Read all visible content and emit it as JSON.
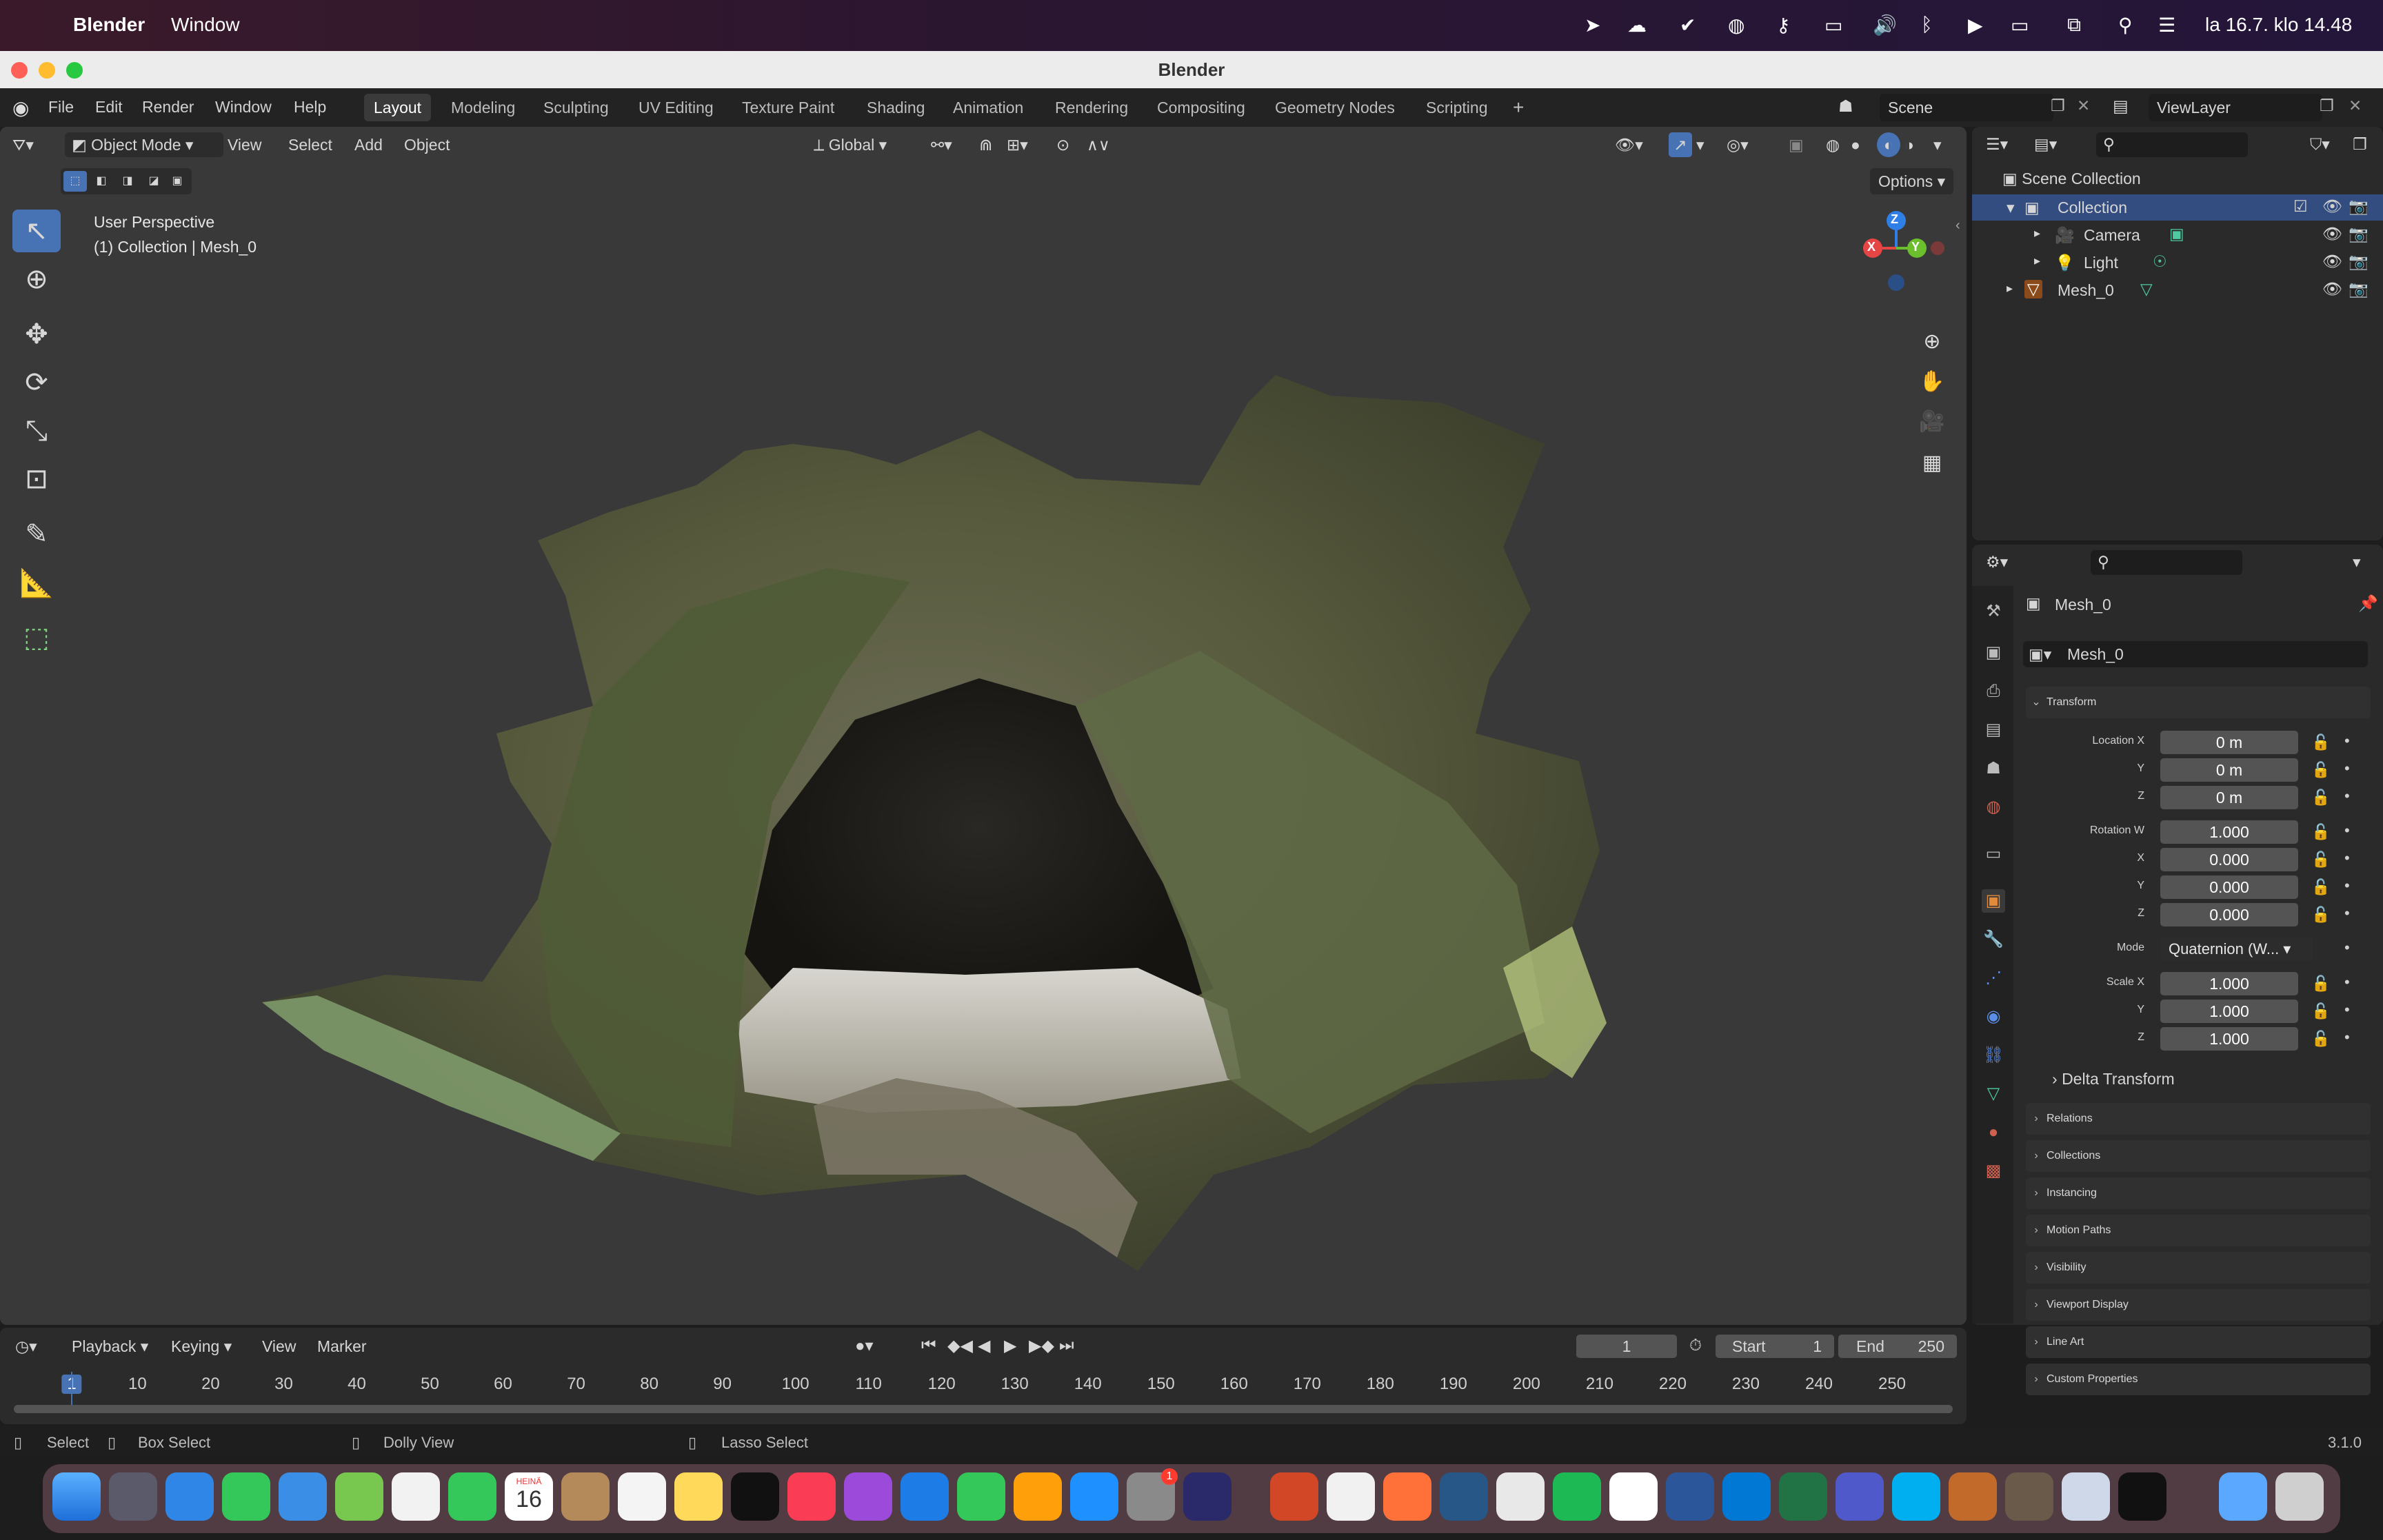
{
  "mac_menubar": {
    "app_name": "Blender",
    "menu": "Window",
    "clock": "la 16.7. klo 14.48"
  },
  "window": {
    "title": "Blender"
  },
  "topbar": {
    "menus": [
      "File",
      "Edit",
      "Render",
      "Window",
      "Help"
    ],
    "workspaces": [
      "Layout",
      "Modeling",
      "Sculpting",
      "UV Editing",
      "Texture Paint",
      "Shading",
      "Animation",
      "Rendering",
      "Compositing",
      "Geometry Nodes",
      "Scripting"
    ],
    "active_workspace": "Layout",
    "add_workspace": "+",
    "scene": "Scene",
    "view_layer": "ViewLayer"
  },
  "viewport": {
    "mode": "Object Mode",
    "menus": [
      "View",
      "Select",
      "Add",
      "Object"
    ],
    "transform_orientation": "Global",
    "options_label": "Options",
    "overlay_line1": "User Perspective",
    "overlay_line2": "(1) Collection | Mesh_0",
    "gizmo": {
      "x": "X",
      "y": "Y",
      "z": "Z"
    }
  },
  "outliner": {
    "scene_collection": "Scene Collection",
    "collection": "Collection",
    "items": [
      "Camera",
      "Light",
      "Mesh_0"
    ]
  },
  "properties": {
    "object_name": "Mesh_0",
    "data_name": "Mesh_0",
    "transform_label": "Transform",
    "location": {
      "label_x": "Location X",
      "label_y": "Y",
      "label_z": "Z",
      "x": "0 m",
      "y": "0 m",
      "z": "0 m"
    },
    "rotation": {
      "label_w": "Rotation W",
      "label_x": "X",
      "label_y": "Y",
      "label_z": "Z",
      "w": "1.000",
      "x": "0.000",
      "y": "0.000",
      "z": "0.000"
    },
    "mode_label": "Mode",
    "mode_value": "Quaternion (W...",
    "scale": {
      "label_x": "Scale X",
      "label_y": "Y",
      "label_z": "Z",
      "x": "1.000",
      "y": "1.000",
      "z": "1.000"
    },
    "delta_transform": "Delta Transform",
    "panels": [
      "Relations",
      "Collections",
      "Instancing",
      "Motion Paths",
      "Visibility",
      "Viewport Display",
      "Line Art",
      "Custom Properties"
    ]
  },
  "timeline": {
    "menus": [
      "Playback",
      "Keying",
      "View",
      "Marker"
    ],
    "current_frame": "1",
    "start_label": "Start",
    "start": "1",
    "end_label": "End",
    "end": "250",
    "ticks": [
      "1",
      "10",
      "20",
      "30",
      "40",
      "50",
      "60",
      "70",
      "80",
      "90",
      "100",
      "110",
      "120",
      "130",
      "140",
      "150",
      "160",
      "170",
      "180",
      "190",
      "200",
      "210",
      "220",
      "230",
      "240",
      "250"
    ]
  },
  "statusbar": {
    "select": "Select",
    "box_select": "Box Select",
    "dolly_view": "Dolly View",
    "lasso_select": "Lasso Select",
    "version": "3.1.0"
  },
  "dock": {
    "calendar_month": "HEINÄ",
    "calendar_day": "16",
    "appstore_badge": "1"
  }
}
